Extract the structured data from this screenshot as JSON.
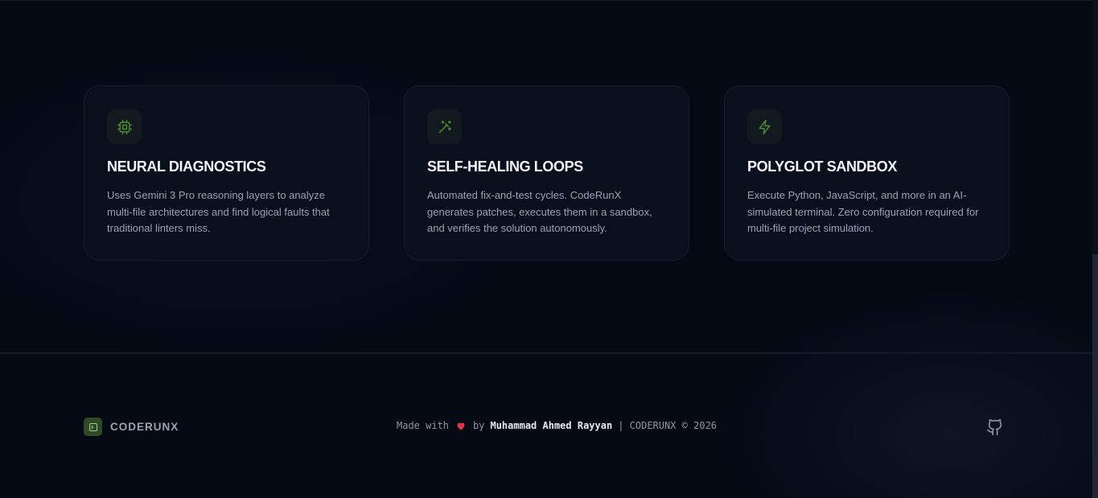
{
  "cards": [
    {
      "icon": "cpu-icon",
      "title": "NEURAL DIAGNOSTICS",
      "description": "Uses Gemini 3 Pro reasoning layers to analyze multi-file architectures and find logical faults that traditional linters miss."
    },
    {
      "icon": "magic-wand-icon",
      "title": "SELF-HEALING LOOPS",
      "description": "Automated fix-and-test cycles. CodeRunX generates patches, executes them in a sandbox, and verifies the solution autonomously."
    },
    {
      "icon": "lightning-icon",
      "title": "POLYGLOT SANDBOX",
      "description": "Execute Python, JavaScript, and more in an AI-simulated terminal. Zero configuration required for multi-file project simulation."
    }
  ],
  "footer": {
    "brand_name": "CODERUNX",
    "brand_icon": "terminal-icon",
    "made_with": "Made with",
    "heart_icon": "heart-icon",
    "by": "by",
    "author": "Muhammad Ahmed Rayyan",
    "suffix": "| CODERUNX © 2026",
    "github_icon": "github-icon"
  },
  "colors": {
    "background": "#050914",
    "card_background": "#0a0f1d",
    "accent_green": "#4e8a2e",
    "heart_red": "#e0334e",
    "title_text": "#f2f4f8",
    "body_text": "#98a2b5"
  }
}
